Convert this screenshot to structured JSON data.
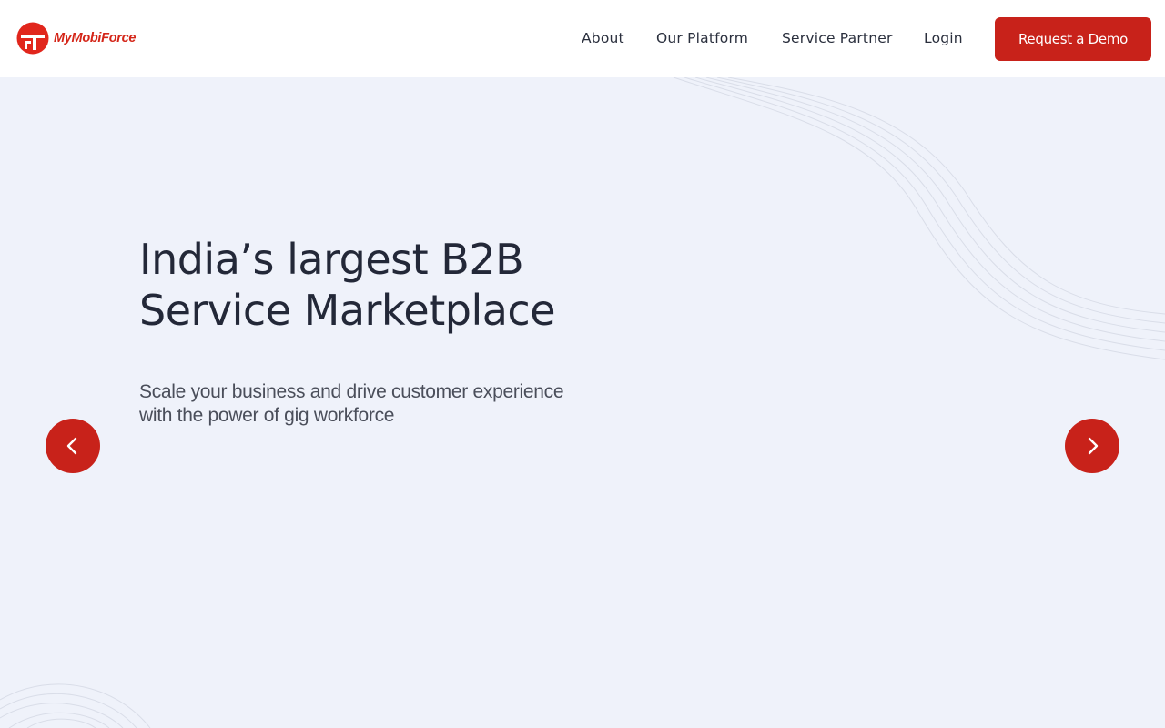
{
  "brand": {
    "name": "MyMobiForce",
    "color": "#d42518"
  },
  "nav": {
    "items": [
      {
        "label": "About"
      },
      {
        "label": "Our Platform"
      },
      {
        "label": "Service Partner"
      },
      {
        "label": "Login"
      }
    ],
    "cta_label": "Request a Demo"
  },
  "hero": {
    "title_line1": "India’s largest B2B",
    "title_line2": "Service Marketplace",
    "subtitle_line1": "Scale your business and drive customer experience",
    "subtitle_line2": "with the power of gig workforce"
  },
  "carousel": {
    "prev_icon": "chevron-left-icon",
    "next_icon": "chevron-right-icon"
  },
  "colors": {
    "accent": "#c8221a",
    "background": "#eff2fa",
    "header_bg": "#ffffff",
    "heading_text": "#232838",
    "body_text": "#4a4e5a"
  }
}
